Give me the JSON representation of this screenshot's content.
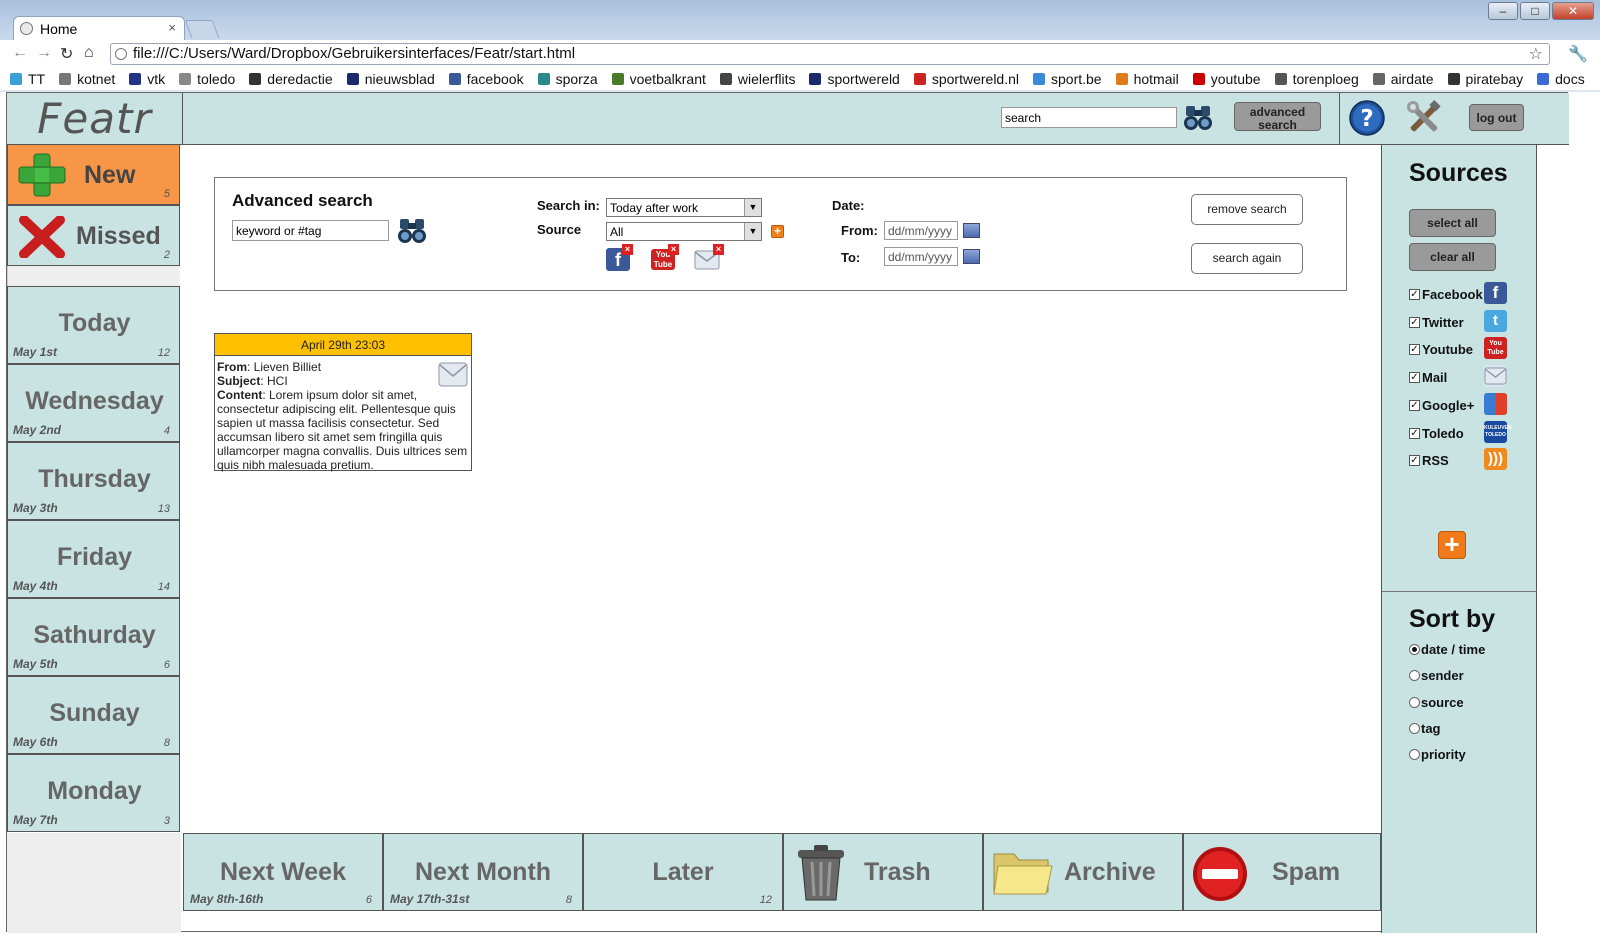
{
  "browser": {
    "tab_title": "Home",
    "url": "file:///C:/Users/Ward/Dropbox/Gebruikersinterfaces/Featr/start.html",
    "bookmarks": [
      {
        "label": "TT",
        "color": "#3aa0d8"
      },
      {
        "label": "kotnet",
        "color": "#777777"
      },
      {
        "label": "vtk",
        "color": "#223388"
      },
      {
        "label": "toledo",
        "color": "#888888"
      },
      {
        "label": "deredactie",
        "color": "#333333"
      },
      {
        "label": "nieuwsblad",
        "color": "#1a2a6c"
      },
      {
        "label": "facebook",
        "color": "#3b5998"
      },
      {
        "label": "sporza",
        "color": "#2a8a8a"
      },
      {
        "label": "voetbalkrant",
        "color": "#4a7a2a"
      },
      {
        "label": "wielerflits",
        "color": "#444444"
      },
      {
        "label": "sportwereld",
        "color": "#1a2a6c"
      },
      {
        "label": "sportwereld.nl",
        "color": "#cc2222"
      },
      {
        "label": "sport.be",
        "color": "#3a8ad8"
      },
      {
        "label": "hotmail",
        "color": "#e07b1a"
      },
      {
        "label": "youtube",
        "color": "#cc0000"
      },
      {
        "label": "torenploeg",
        "color": "#555555"
      },
      {
        "label": "airdate",
        "color": "#666666"
      },
      {
        "label": "piratebay",
        "color": "#333333"
      },
      {
        "label": "docs",
        "color": "#3a6ad8"
      }
    ]
  },
  "app": {
    "logo": "Featr",
    "search_value": "search",
    "advanced_search_label": "advanced search",
    "logout_label": "log out"
  },
  "nav": {
    "new": {
      "label": "New",
      "count": "5"
    },
    "missed": {
      "label": "Missed",
      "count": "2"
    },
    "days": [
      {
        "name": "Today",
        "date": "May 1st",
        "count": "12"
      },
      {
        "name": "Wednesday",
        "date": "May 2nd",
        "count": "4"
      },
      {
        "name": "Thursday",
        "date": "May 3th",
        "count": "13"
      },
      {
        "name": "Friday",
        "date": "May 4th",
        "count": "14"
      },
      {
        "name": "Sathurday",
        "date": "May 5th",
        "count": "6"
      },
      {
        "name": "Sunday",
        "date": "May 6th",
        "count": "8"
      },
      {
        "name": "Monday",
        "date": "May 7th",
        "count": "3"
      }
    ]
  },
  "bottom": {
    "next_week": {
      "name": "Next Week",
      "date": "May 8th-16th",
      "count": "6"
    },
    "next_month": {
      "name": "Next Month",
      "date": "May 17th-31st",
      "count": "8"
    },
    "later": {
      "name": "Later",
      "count": "12"
    },
    "trash": "Trash",
    "archive": "Archive",
    "spam": "Spam"
  },
  "advanced": {
    "title": "Advanced search",
    "keyword_value": "keyword or #tag",
    "search_in_label": "Search in:",
    "search_in_value": "Today after work",
    "source_label": "Source",
    "source_value": "All",
    "date_label": "Date:",
    "from_label": "From:",
    "to_label": "To:",
    "from_value": "dd/mm/yyyy",
    "to_value": "dd/mm/yyyy",
    "remove_label": "remove search",
    "again_label": "search again"
  },
  "message": {
    "datetime": "April 29th 23:03",
    "from_label": "From",
    "from": "Lieven Billiet",
    "subject_label": "Subject",
    "subject": "HCI",
    "content_label": "Content",
    "content": "Lorem ipsum dolor sit amet, consectetur adipiscing elit. Pellentesque quis sapien ut massa facilisis consectetur. Sed accumsan libero sit amet sem fringilla quis ullamcorper magna convallis. Duis ultrices sem quis nibh malesuada pretium."
  },
  "sources": {
    "title": "Sources",
    "select_all": "select all",
    "clear_all": "clear all",
    "items": [
      {
        "label": "Facebook",
        "checked": true,
        "color": "#3b5998"
      },
      {
        "label": "Twitter",
        "checked": true,
        "color": "#4aa8e0"
      },
      {
        "label": "Youtube",
        "checked": true,
        "color": "#cc2222"
      },
      {
        "label": "Mail",
        "checked": true,
        "color": "#dde4ee"
      },
      {
        "label": "Google+",
        "checked": true,
        "color": "#4a9a3a"
      },
      {
        "label": "Toledo",
        "checked": true,
        "color": "#1a4aa0"
      },
      {
        "label": "RSS",
        "checked": true,
        "color": "#f08a20"
      }
    ]
  },
  "sort": {
    "title": "Sort by",
    "options": [
      {
        "label": "date / time",
        "selected": true
      },
      {
        "label": "sender",
        "selected": false
      },
      {
        "label": "source",
        "selected": false
      },
      {
        "label": "tag",
        "selected": false
      },
      {
        "label": "priority",
        "selected": false
      }
    ]
  },
  "colors": {
    "panel": "#c9e3e3",
    "accent_new": "#f79646",
    "card_header": "#ffc000"
  }
}
